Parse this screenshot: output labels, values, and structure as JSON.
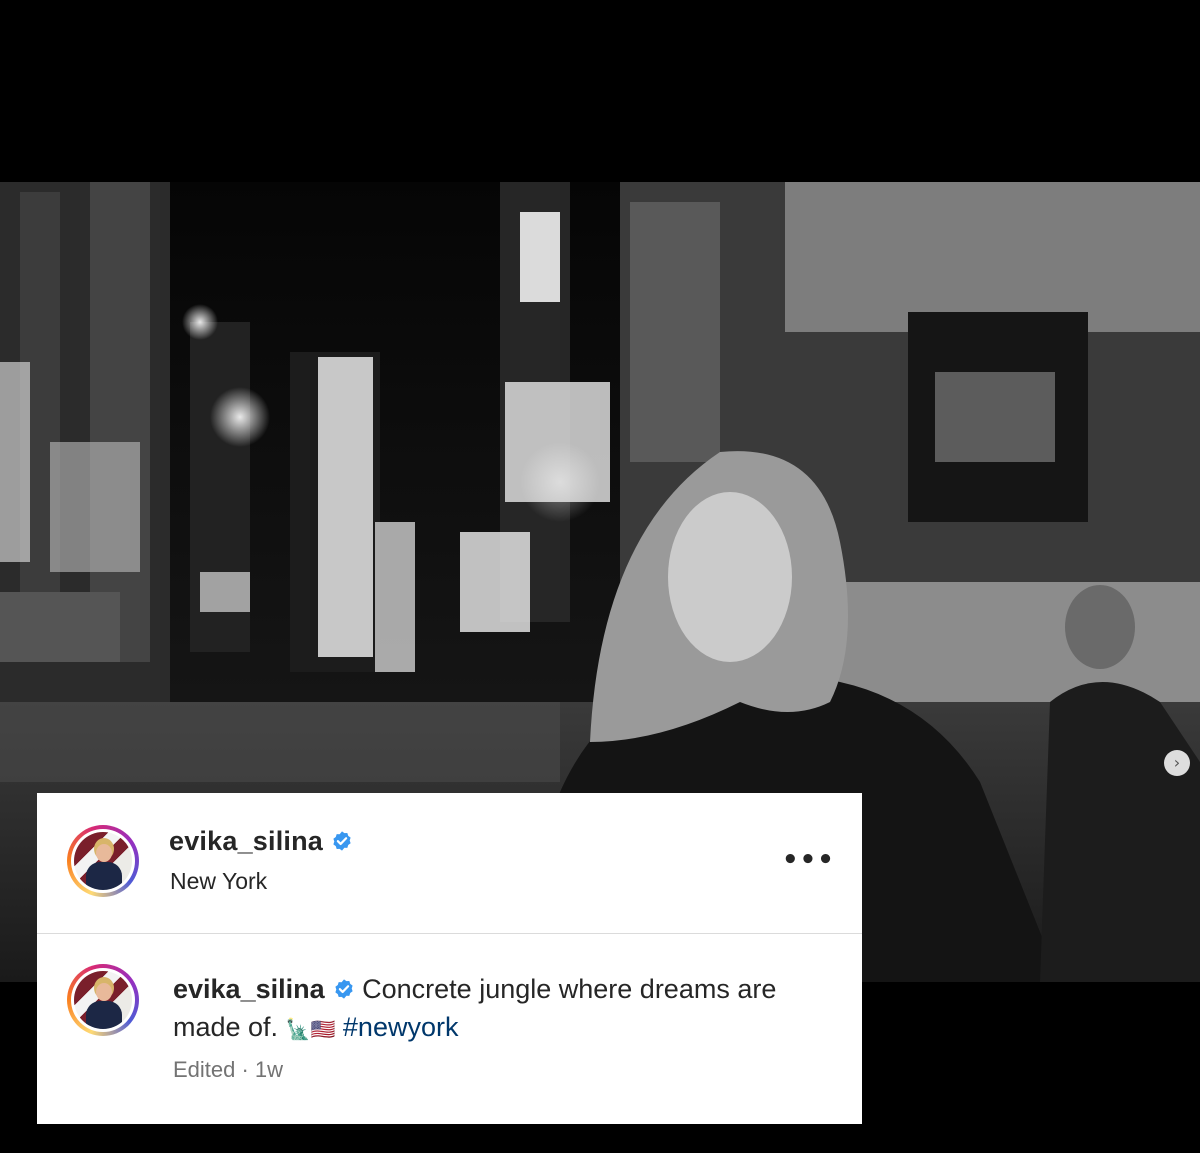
{
  "post": {
    "username": "evika_silina",
    "location": "New York",
    "caption_text": "Concrete jungle where dreams are made of.",
    "caption_emoji": "🗽🇺🇸",
    "hashtag": "#newyork",
    "meta": "Edited · 1w",
    "more_label": "•••",
    "next_label": "›"
  },
  "colors": {
    "verified_blue": "#3897f0",
    "hashtag_blue": "#00376b",
    "meta_gray": "#737373"
  },
  "icons": [
    "verified-badge-icon",
    "more-options-icon",
    "chevron-right-icon"
  ]
}
